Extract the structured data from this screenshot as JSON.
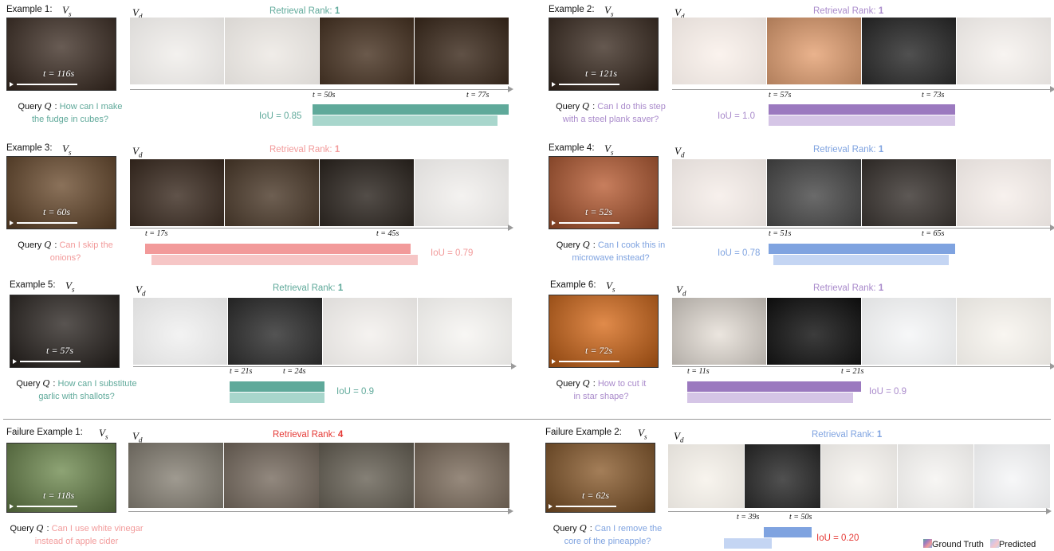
{
  "colors": {
    "teal_gt": "#5fa99a",
    "teal_pred": "#a8d6cc",
    "purple_gt": "#9b79bf",
    "purple_pred": "#d5c5e6",
    "red_gt": "#f29a9a",
    "red_pred": "#f6c6c6",
    "blue_gt": "#7fa3e0",
    "blue_pred": "#c4d5f3",
    "teal_text": "#5fa99a",
    "purple_text": "#a98acb",
    "red_text": "#f29a9a",
    "blue_text": "#7fa3e0",
    "fail_red": "#e53935"
  },
  "common": {
    "vs": "V",
    "vd": "V",
    "query_key": "Query",
    "query_sym": "Q",
    "rank_label": "Retrieval Rank:"
  },
  "examples": [
    {
      "label": "Example 1:",
      "ts": "t = 116s",
      "rank": "1",
      "query1": "How can I make",
      "query2": "the fudge in cubes?",
      "iou": "IoU = 0.85",
      "ts_start": "t = 50s",
      "ts_end": "t = 77s",
      "thumb_color": "#3e2e24"
    },
    {
      "label": "Example 2:",
      "ts": "t = 121s",
      "rank": "1",
      "query1": "Can I do this step",
      "query2": "with a steel plank saver?",
      "iou": "IoU = 1.0",
      "ts_start": "t = 57s",
      "ts_end": "t = 73s",
      "thumb_color": "#3a2a1f"
    },
    {
      "label": "Example 3:",
      "ts": "t = 60s",
      "rank": "1",
      "query1": "Can I skip the",
      "query2": "onions?",
      "iou": "IoU = 0.79",
      "ts_start": "t = 17s",
      "ts_end": "t = 45s",
      "thumb_color": "#6a4a2c"
    },
    {
      "label": "Example 4:",
      "ts": "t = 52s",
      "rank": "1",
      "query1": "Can I cook this in",
      "query2": "microwave instead?",
      "iou": "IoU = 0.78",
      "ts_start": "t = 51s",
      "ts_end": "t = 65s",
      "thumb_color": "#b85a30"
    },
    {
      "label": "Example 5:",
      "ts": "t = 57s",
      "rank": "1",
      "query1": "How can I substitute",
      "query2": "garlic with shallots?",
      "iou": "IoU = 0.9",
      "ts_start": "t = 21s",
      "ts_end": "t = 24s",
      "thumb_color": "#2a2420"
    },
    {
      "label": "Example 6:",
      "ts": "t = 72s",
      "rank": "1",
      "query1": "How to cut it",
      "query2": "in star shape?",
      "iou": "IoU = 0.9",
      "ts_start": "t = 11s",
      "ts_end": "t = 21s",
      "thumb_color": "#d86a18"
    },
    {
      "label": "Failure Example 1:",
      "ts": "t = 118s",
      "rank": "4",
      "query1": "Can I use white vinegar",
      "query2": "instead of apple cider",
      "iou": "",
      "ts_start": "",
      "ts_end": "",
      "thumb_color": "#6e8a4e"
    },
    {
      "label": "Failure Example 2:",
      "ts": "t = 62s",
      "rank": "1",
      "query1": "Can I remove the",
      "query2": "core of the pineapple?",
      "iou": "IoU = 0.20",
      "ts_start": "t = 39s",
      "ts_end": "t = 50s",
      "thumb_color": "#8a5a2a"
    }
  ],
  "legend": {
    "gt": "Ground Truth",
    "pred": "Predicted"
  }
}
